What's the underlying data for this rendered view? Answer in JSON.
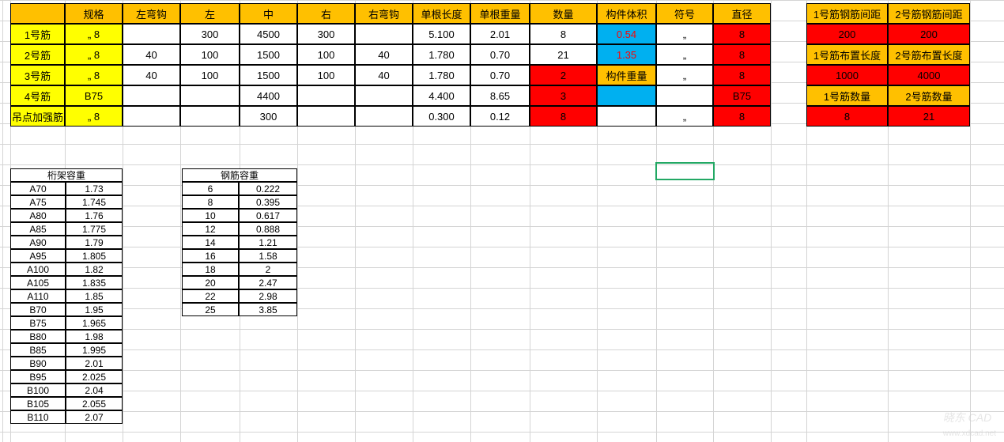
{
  "main": {
    "headers": [
      "",
      "规格",
      "左弯钩",
      "左",
      "中",
      "右",
      "右弯钩",
      "单根长度",
      "单根重量",
      "数量",
      "构件体积",
      "符号",
      "直径"
    ],
    "rows": [
      {
        "label": "1号筋",
        "spec": "„ 8",
        "lhook": "",
        "left": "300",
        "mid": "4500",
        "right": "300",
        "rhook": "",
        "len": "5.100",
        "weight": "2.01",
        "qty": "8",
        "vol": "0.54",
        "sym": "„",
        "dia": "8"
      },
      {
        "label": "2号筋",
        "spec": "„ 8",
        "lhook": "40",
        "left": "100",
        "mid": "1500",
        "right": "100",
        "rhook": "40",
        "len": "1.780",
        "weight": "0.70",
        "qty": "21",
        "vol": "1.35",
        "sym": "„",
        "dia": "8"
      },
      {
        "label": "3号筋",
        "spec": "„ 8",
        "lhook": "40",
        "left": "100",
        "mid": "1500",
        "right": "100",
        "rhook": "40",
        "len": "1.780",
        "weight": "0.70",
        "qty": "2",
        "vol": "构件重量",
        "sym": "„",
        "dia": "8"
      },
      {
        "label": "4号筋",
        "spec": "B75",
        "lhook": "",
        "left": "",
        "mid": "4400",
        "right": "",
        "rhook": "",
        "len": "4.400",
        "weight": "8.65",
        "qty": "3",
        "vol": "",
        "sym": "",
        "dia": "B75"
      },
      {
        "label": "吊点加强筋",
        "spec": "„ 8",
        "lhook": "",
        "left": "",
        "mid": "300",
        "right": "",
        "rhook": "",
        "len": "0.300",
        "weight": "0.12",
        "qty": "8",
        "vol": "",
        "sym": "„",
        "dia": "8"
      }
    ]
  },
  "side": {
    "row1": [
      "1号筋钢筋间距",
      "2号筋钢筋间距"
    ],
    "row2": [
      "200",
      "200"
    ],
    "row3": [
      "1号筋布置长度",
      "2号筋布置长度"
    ],
    "row4": [
      "1000",
      "4000"
    ],
    "row5": [
      "1号筋数量",
      "2号筋数量"
    ],
    "row6": [
      "8",
      "21"
    ]
  },
  "truss": {
    "title": "桁架容重",
    "data": [
      [
        "A70",
        "1.73"
      ],
      [
        "A75",
        "1.745"
      ],
      [
        "A80",
        "1.76"
      ],
      [
        "A85",
        "1.775"
      ],
      [
        "A90",
        "1.79"
      ],
      [
        "A95",
        "1.805"
      ],
      [
        "A100",
        "1.82"
      ],
      [
        "A105",
        "1.835"
      ],
      [
        "A110",
        "1.85"
      ],
      [
        "B70",
        "1.95"
      ],
      [
        "B75",
        "1.965"
      ],
      [
        "B80",
        "1.98"
      ],
      [
        "B85",
        "1.995"
      ],
      [
        "B90",
        "2.01"
      ],
      [
        "B95",
        "2.025"
      ],
      [
        "B100",
        "2.04"
      ],
      [
        "B105",
        "2.055"
      ],
      [
        "B110",
        "2.07"
      ]
    ]
  },
  "rebar": {
    "title": "钢筋容重",
    "data": [
      [
        "6",
        "0.222"
      ],
      [
        "8",
        "0.395"
      ],
      [
        "10",
        "0.617"
      ],
      [
        "12",
        "0.888"
      ],
      [
        "14",
        "1.21"
      ],
      [
        "16",
        "1.58"
      ],
      [
        "18",
        "2"
      ],
      [
        "20",
        "2.47"
      ],
      [
        "22",
        "2.98"
      ],
      [
        "25",
        "3.85"
      ]
    ]
  },
  "watermark": {
    "main": "晓东 CAD",
    "sub": "www.xdcad.net"
  }
}
